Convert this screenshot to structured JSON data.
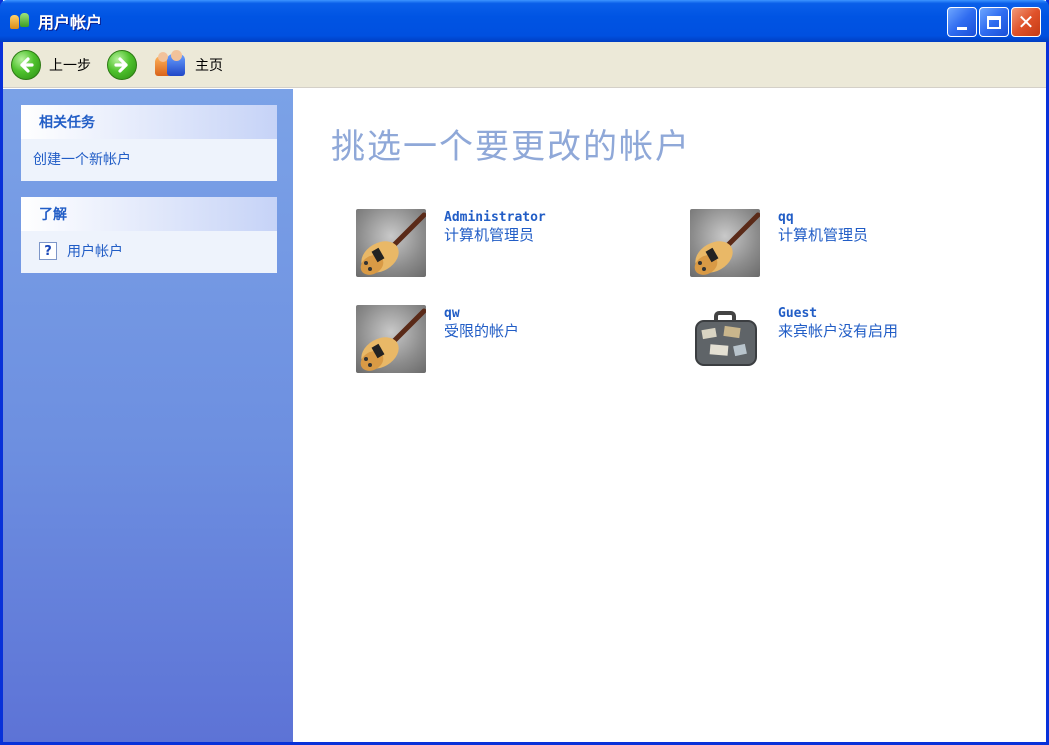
{
  "window": {
    "title": "用户帐户",
    "buttons": {
      "minimize": "minimize",
      "maximize": "maximize",
      "close": "close"
    }
  },
  "toolbar": {
    "back_label": "上一步",
    "home_label": "主页"
  },
  "sidebar": {
    "panels": [
      {
        "title": "相关任务",
        "links": [
          "创建一个新帐户"
        ]
      },
      {
        "title": "了解",
        "links": [
          "用户帐户"
        ]
      }
    ]
  },
  "main": {
    "heading": "挑选一个要更改的帐户",
    "accounts": [
      {
        "name": "Administrator",
        "role": "计算机管理员",
        "picture": "guitar"
      },
      {
        "name": "qq",
        "role": "计算机管理员",
        "picture": "guitar"
      },
      {
        "name": "qw",
        "role": "受限的帐户",
        "picture": "guitar"
      },
      {
        "name": "Guest",
        "role": "来宾帐户没有启用",
        "picture": "suitcase"
      }
    ]
  },
  "icons": {
    "title_icon": "user-accounts-icon",
    "back": "back-arrow-icon",
    "forward": "forward-arrow-icon",
    "home": "users-home-icon",
    "help": "help-icon"
  },
  "colors": {
    "titlebar": "#0054e3",
    "sidebar": "#6d8fe0",
    "link": "#215dc6",
    "heading": "#8fa8d8",
    "toolbar": "#ece9d8"
  }
}
